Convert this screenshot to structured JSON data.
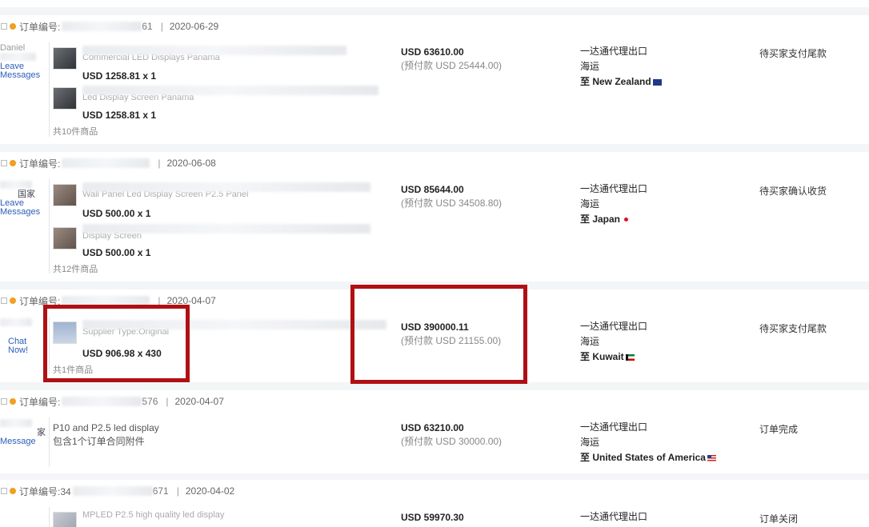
{
  "orders": [
    {
      "header": {
        "label": "订单编号:",
        "number_tail": "61",
        "date": "2020-06-29"
      },
      "seller": {
        "name": "Daniel",
        "link": "Leave Messages"
      },
      "items": [
        {
          "title": "Commercial LED Displays Panama",
          "price": "USD 1258.81 x 1"
        },
        {
          "title": "Led Display Screen Panama",
          "price": "USD 1258.81 x 1"
        }
      ],
      "count": "共10件商品",
      "amount": "USD 63610.00",
      "prepay": "(预付款 USD 25444.00)",
      "ship_method": "一达通代理出口",
      "ship_mode": "海运",
      "destination": "至 New Zealand",
      "flag": "nz-flag",
      "status": "待买家支付尾款"
    },
    {
      "header": {
        "label": "订单编号:",
        "number_tail": "",
        "date": "2020-06-08"
      },
      "seller": {
        "name": "国家",
        "link": "Leave Messages"
      },
      "items": [
        {
          "title": "Wall Panel Led Display Screen P2.5 Panel",
          "price": "USD 500.00 x 1"
        },
        {
          "title": "Display Screen",
          "price": "USD 500.00 x 1"
        }
      ],
      "count": "共12件商品",
      "amount": "USD 85644.00",
      "prepay": "(预付款 USD 34508.80)",
      "ship_method": "一达通代理出口",
      "ship_mode": "海运",
      "destination": "至 Japan",
      "flag": "jp-flag",
      "status": "待买家确认收货"
    },
    {
      "header": {
        "label": "订单编号:",
        "number_tail": "",
        "date": "2020-04-07"
      },
      "seller": {
        "name": "",
        "link": "Chat Now!"
      },
      "items": [
        {
          "title": "Supplier Type:Original",
          "price": "USD 906.98 x 430"
        }
      ],
      "count": "共1件商品",
      "amount": "USD 390000.11",
      "prepay": "(预付款 USD 21155.00)",
      "ship_method": "一达通代理出口",
      "ship_mode": "海运",
      "destination": "至 Kuwait",
      "flag": "kw-flag",
      "status": "待买家支付尾款"
    },
    {
      "header": {
        "label": "订单编号:",
        "number_tail": "576",
        "date": "2020-04-07"
      },
      "seller": {
        "name": "家",
        "link": "Message"
      },
      "items": [
        {
          "title": "P10 and P2.5 led display",
          "price": ""
        }
      ],
      "count": "包含1个订单合同附件",
      "amount": "USD 63210.00",
      "prepay": "(预付款 USD 30000.00)",
      "ship_method": "一达通代理出口",
      "ship_mode": "海运",
      "destination": "至 United States of America",
      "flag": "us-flag",
      "status": "订单完成"
    },
    {
      "header": {
        "label": "订单编号:34",
        "number_tail": "671",
        "date": "2020-04-02"
      },
      "seller": {
        "name": "",
        "link": ""
      },
      "items": [
        {
          "title": "MPLED P2.5 high quality led display",
          "price": ""
        }
      ],
      "count": "",
      "amount": "USD 59970.30",
      "prepay": "",
      "ship_method": "一达通代理出口",
      "ship_mode": "",
      "destination": "",
      "flag": "",
      "status": "订单关闭"
    }
  ],
  "highlight_colors": {
    "annotation_box": "#b01014",
    "flag_jp": "#dd1122"
  }
}
